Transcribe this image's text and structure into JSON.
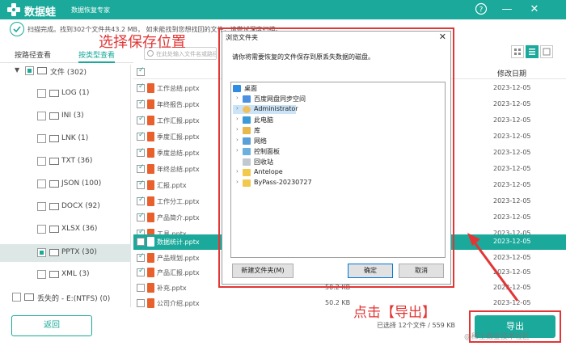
{
  "app": {
    "name": "数据蛙",
    "subtitle": "数据恢复专家",
    "help_glyph": "?",
    "minimize_glyph": "—",
    "close_glyph": "✕"
  },
  "status": {
    "text": "扫描完成。找到302个文件共43.2 MB，  如未能找到您想找回的文件，请尝试深度扫描。"
  },
  "tabs": [
    {
      "label": "按路径查看"
    },
    {
      "label": "按类型查看"
    }
  ],
  "search": {
    "placeholder": "在此处输入文件名或路径"
  },
  "tree": {
    "root": "文件 (302)",
    "items": [
      {
        "label": "LOG (1)"
      },
      {
        "label": "INI (3)"
      },
      {
        "label": "LNK (1)"
      },
      {
        "label": "TXT (36)"
      },
      {
        "label": "JSON (100)"
      },
      {
        "label": "DOCX (92)"
      },
      {
        "label": "XLSX (36)"
      },
      {
        "label": "PPTX (30)"
      },
      {
        "label": "XML (3)"
      }
    ],
    "lost": "丢失的 - E:(NTFS) (0)"
  },
  "list": {
    "col_name": "名称",
    "col_date": "修改日期",
    "rows": [
      {
        "name": "工作总结.pptx",
        "size": "",
        "date": "2023-12-05"
      },
      {
        "name": "年终报告.pptx",
        "size": "",
        "date": "2023-12-05"
      },
      {
        "name": "工作汇报.pptx",
        "size": "",
        "date": "2023-12-05"
      },
      {
        "name": "季度汇报.pptx",
        "size": "",
        "date": "2023-12-05"
      },
      {
        "name": "季度总结.pptx",
        "size": "",
        "date": "2023-12-05"
      },
      {
        "name": "年终总结.pptx",
        "size": "",
        "date": "2023-12-05"
      },
      {
        "name": "汇报.pptx",
        "size": "",
        "date": "2023-12-05"
      },
      {
        "name": "工作分工.pptx",
        "size": "",
        "date": "2023-12-05"
      },
      {
        "name": "产品简介.pptx",
        "size": "",
        "date": "2023-12-05"
      },
      {
        "name": "工具.pptx",
        "size": "",
        "date": "2023-12-05"
      },
      {
        "name": "数据统计.pptx",
        "size": "",
        "date": "2023-12-05"
      },
      {
        "name": "产品规划.pptx",
        "size": "",
        "date": "2023-12-05"
      },
      {
        "name": "产品汇报.pptx",
        "size": "",
        "date": "2023-12-05"
      },
      {
        "name": "补充.pptx",
        "size": "50.2 KB",
        "date": "2023-12-05"
      },
      {
        "name": "公司介绍.pptx",
        "size": "50.2 KB",
        "date": "2023-12-05"
      }
    ]
  },
  "bottom": {
    "back_label": "返回",
    "selected_summary": "已选择 12个文件 / 559 KB",
    "export_label": "导出",
    "watermark": "@稀土掘金技术社区"
  },
  "annotations": {
    "top": "选择保存位置",
    "bottom": "点击【导出】"
  },
  "dialog": {
    "title": "浏览文件夹",
    "close_glyph": "✕",
    "message": "请你将需要恢复的文件保存到原丢失数据的磁盘。",
    "nodes": [
      {
        "label": "桌面"
      },
      {
        "label": "百度网盘同步空间"
      },
      {
        "label": "Administrator"
      },
      {
        "label": "此电脑"
      },
      {
        "label": "库"
      },
      {
        "label": "网络"
      },
      {
        "label": "控制面板"
      },
      {
        "label": "回收站"
      },
      {
        "label": "Antelope"
      },
      {
        "label": "ByPass-20230727"
      }
    ],
    "new_folder": "新建文件夹(M)",
    "ok": "确定",
    "cancel": "取消"
  },
  "colors": {
    "accent": "#1aa99a",
    "annotation_red": "#e23636"
  }
}
